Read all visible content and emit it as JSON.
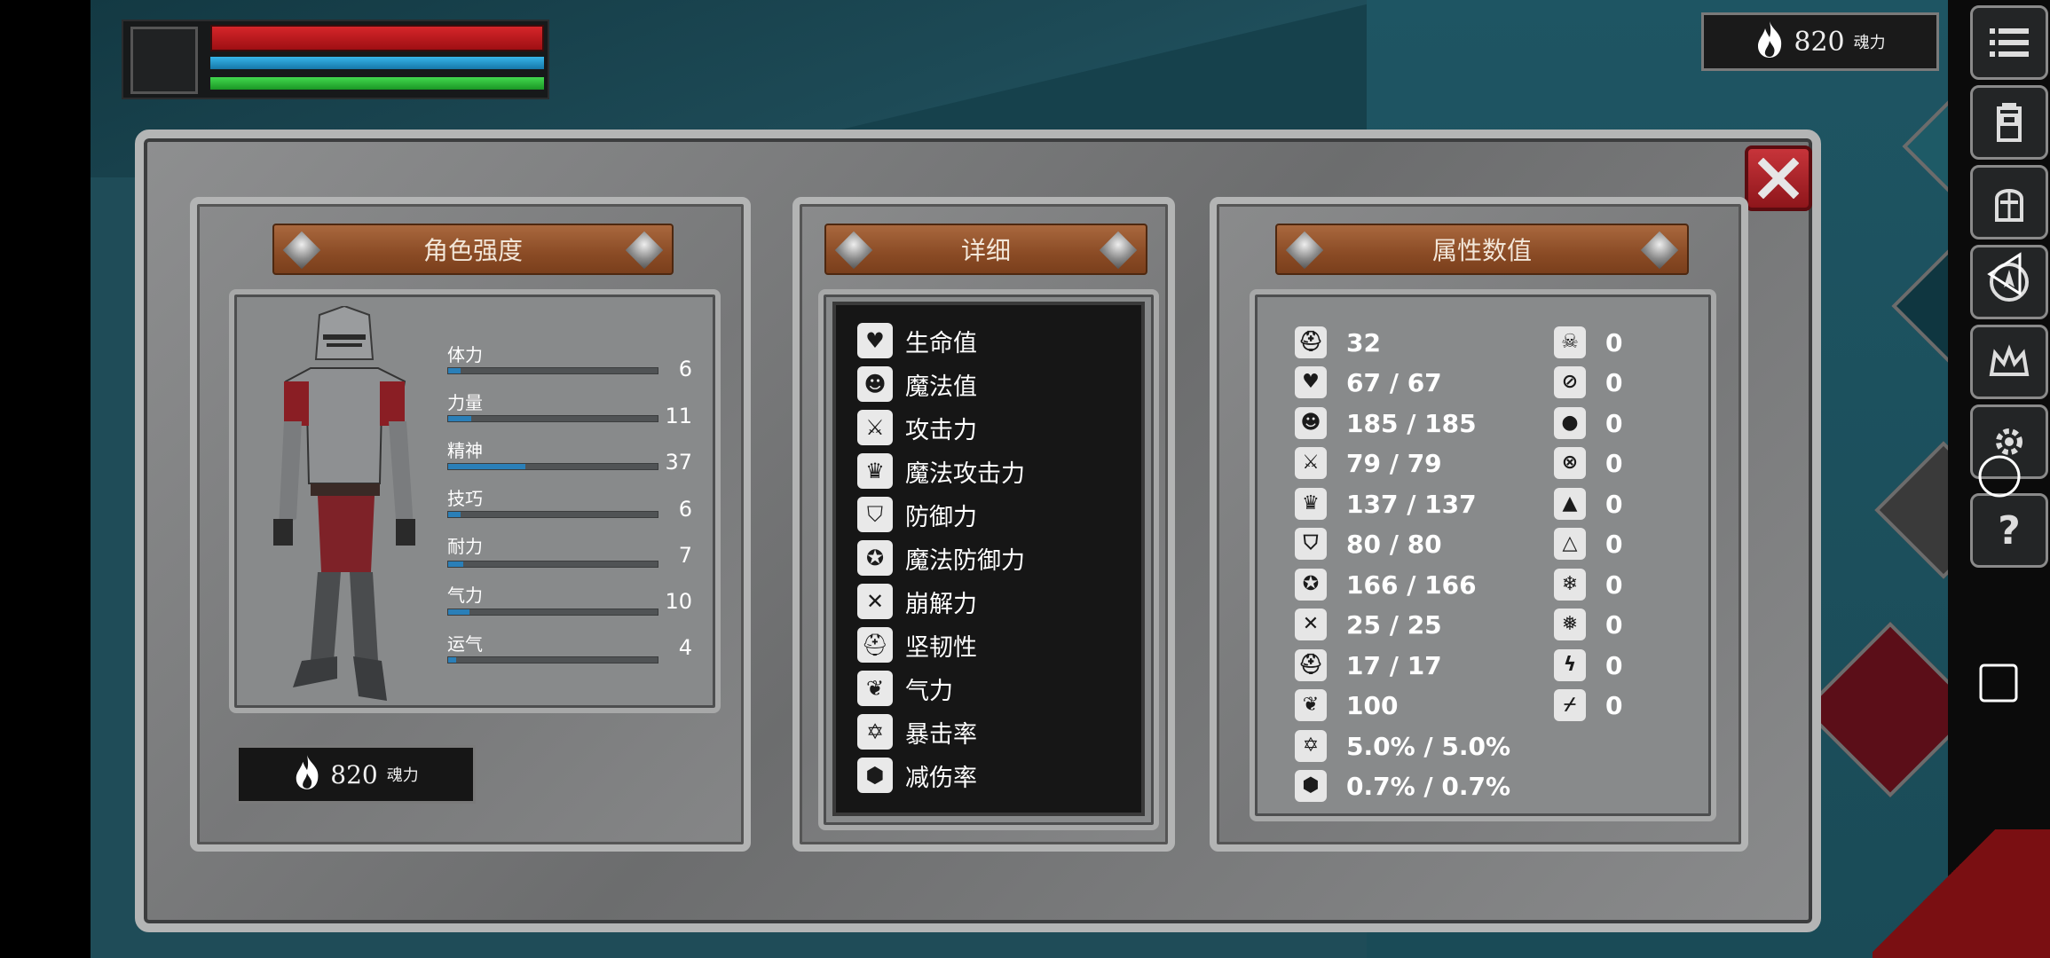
{
  "hud": {
    "soul_amount": "820",
    "soul_unit": "魂力"
  },
  "panel": {
    "left_title": "角色强度",
    "middle_title": "详细",
    "right_title": "属性数值"
  },
  "stats": [
    {
      "label": "体力",
      "value": "6",
      "fill": 0.06
    },
    {
      "label": "力量",
      "value": "11",
      "fill": 0.11
    },
    {
      "label": "精神",
      "value": "37",
      "fill": 0.37
    },
    {
      "label": "技巧",
      "value": "6",
      "fill": 0.06
    },
    {
      "label": "耐力",
      "value": "7",
      "fill": 0.07
    },
    {
      "label": "气力",
      "value": "10",
      "fill": 0.1
    },
    {
      "label": "运气",
      "value": "4",
      "fill": 0.04
    }
  ],
  "soul_panel": {
    "amount": "820",
    "unit": "魂力"
  },
  "details": [
    {
      "label": "生命值",
      "icon": "heart-icon"
    },
    {
      "label": "魔法值",
      "icon": "head-icon"
    },
    {
      "label": "攻击力",
      "icon": "sword-icon"
    },
    {
      "label": "魔法攻击力",
      "icon": "magic-attack-icon"
    },
    {
      "label": "防御力",
      "icon": "shield-icon"
    },
    {
      "label": "魔法防御力",
      "icon": "magic-shield-icon"
    },
    {
      "label": "崩解力",
      "icon": "break-icon"
    },
    {
      "label": "坚韧性",
      "icon": "helmet-icon"
    },
    {
      "label": "气力",
      "icon": "lungs-icon"
    },
    {
      "label": "暴击率",
      "icon": "crit-icon"
    },
    {
      "label": "减伤率",
      "icon": "damage-reduction-icon"
    }
  ],
  "attributes_left": [
    {
      "icon": "level-helmet-icon",
      "value": "32"
    },
    {
      "icon": "heart-icon",
      "value": "67 / 67"
    },
    {
      "icon": "head-icon",
      "value": "185 / 185"
    },
    {
      "icon": "sword-icon",
      "value": "79 / 79"
    },
    {
      "icon": "magic-attack-icon",
      "value": "137 / 137"
    },
    {
      "icon": "shield-icon",
      "value": "80 / 80"
    },
    {
      "icon": "magic-shield-icon",
      "value": "166 / 166"
    },
    {
      "icon": "break-icon",
      "value": "25 / 25"
    },
    {
      "icon": "helmet-icon",
      "value": "17 / 17"
    },
    {
      "icon": "lungs-icon",
      "value": "100"
    },
    {
      "icon": "crit-icon",
      "value": "5.0% / 5.0%"
    },
    {
      "icon": "damage-reduction-icon",
      "value": "0.7% / 0.7%"
    }
  ],
  "attributes_right": [
    {
      "icon": "poison-icon",
      "value": "0"
    },
    {
      "icon": "poison-resist-icon",
      "value": "0"
    },
    {
      "icon": "bleed-icon",
      "value": "0"
    },
    {
      "icon": "bleed-resist-icon",
      "value": "0"
    },
    {
      "icon": "fire-icon",
      "value": "0"
    },
    {
      "icon": "fire-resist-icon",
      "value": "0"
    },
    {
      "icon": "frost-icon",
      "value": "0"
    },
    {
      "icon": "frost-resist-icon",
      "value": "0"
    },
    {
      "icon": "lightning-icon",
      "value": "0"
    },
    {
      "icon": "lightning-resist-icon",
      "value": "0"
    }
  ],
  "side_menu": [
    {
      "icon": "menu-list-icon"
    },
    {
      "icon": "backpack-icon"
    },
    {
      "icon": "helmet-icon"
    },
    {
      "icon": "compass-icon"
    },
    {
      "icon": "crown-icon"
    },
    {
      "icon": "gear-icon"
    },
    {
      "icon": "help-icon"
    }
  ],
  "help_glyph": "?",
  "colors": {
    "health": "#c81e22",
    "mana": "#2a9fd6",
    "stamina": "#2fbd3b",
    "close_button": "#b0262c",
    "stat_fill": "#2a7fb8"
  }
}
